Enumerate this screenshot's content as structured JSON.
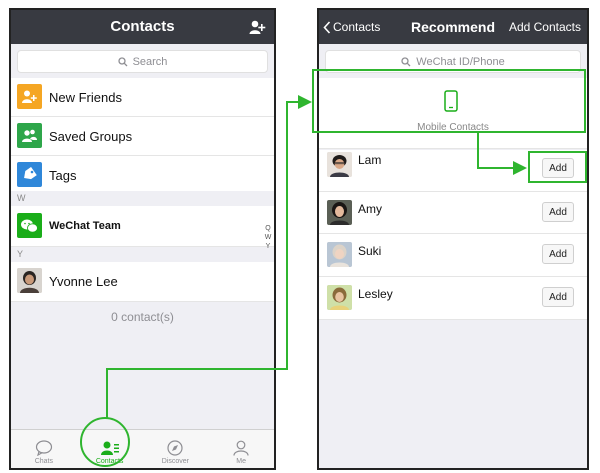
{
  "left": {
    "title": "Contacts",
    "search_placeholder": "Search",
    "menu": [
      {
        "label": "New Friends",
        "color": "#f5a623"
      },
      {
        "label": "Saved Groups",
        "color": "#2ea64a"
      },
      {
        "label": "Tags",
        "color": "#2f87d9"
      }
    ],
    "section_w": "W",
    "wechat_team": "WeChat Team",
    "section_y": "Y",
    "yvonne": "Yvonne Lee",
    "count": "0 contact(s)",
    "index": [
      "Q",
      "W",
      "Y"
    ],
    "tabs": [
      {
        "label": "Chats",
        "icon": "chat-bubble-icon"
      },
      {
        "label": "Contacts",
        "icon": "contacts-icon"
      },
      {
        "label": "Discover",
        "icon": "compass-icon"
      },
      {
        "label": "Me",
        "icon": "person-icon"
      }
    ]
  },
  "right": {
    "back_label": "Contacts",
    "title": "Recommend",
    "add_contacts": "Add Contacts",
    "search_placeholder": "WeChat ID/Phone",
    "mobile_contacts": "Mobile Contacts",
    "people": [
      {
        "name": "Lam",
        "button": "Add"
      },
      {
        "name": "Amy",
        "button": "Add"
      },
      {
        "name": "Suki",
        "button": "Add"
      },
      {
        "name": "Lesley",
        "button": "Add"
      }
    ]
  },
  "colors": {
    "accent": "#1aad19",
    "highlight": "#2fb52f",
    "navbar": "#383a41"
  }
}
